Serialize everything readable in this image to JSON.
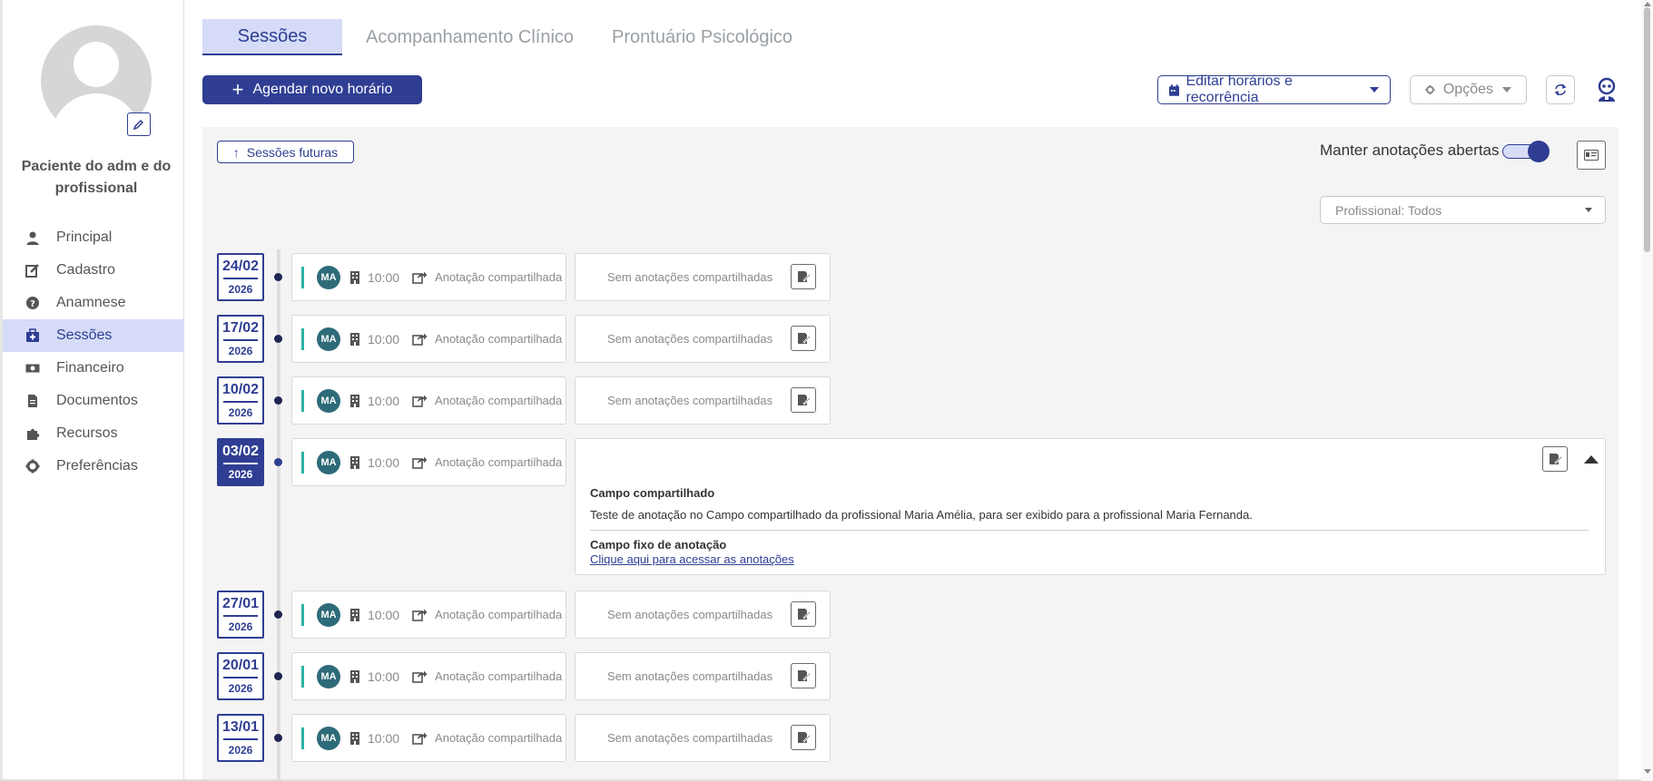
{
  "sidebar": {
    "patient_name": "Paciente do adm e do profissional",
    "items": [
      {
        "label": "Principal",
        "icon": "user-icon"
      },
      {
        "label": "Cadastro",
        "icon": "edit-icon"
      },
      {
        "label": "Anamnese",
        "icon": "question-icon"
      },
      {
        "label": "Sessões",
        "icon": "medical-kit-icon",
        "active": true
      },
      {
        "label": "Financeiro",
        "icon": "money-icon"
      },
      {
        "label": "Documentos",
        "icon": "document-icon"
      },
      {
        "label": "Recursos",
        "icon": "puzzle-icon"
      },
      {
        "label": "Preferências",
        "icon": "gear-icon"
      }
    ]
  },
  "tabs": [
    "Sessões",
    "Acompanhamento Clínico",
    "Prontuário Psicológico"
  ],
  "toolbar": {
    "schedule_label": "Agendar novo horário",
    "edit_schedule_label": "Editar horários e recorrência",
    "options_label": "Opções"
  },
  "panel": {
    "future_sessions_label": "Sessões futuras",
    "keep_notes_label": "Manter anotações abertas",
    "keep_notes_on": true,
    "professional_filter": "Profissional: Todos"
  },
  "sessions": [
    {
      "date": "24/02",
      "year": "2026",
      "initials": "MA",
      "time": "10:00",
      "share_label": "Anotação compartilhada",
      "notes": "Sem anotações compartilhadas"
    },
    {
      "date": "17/02",
      "year": "2026",
      "initials": "MA",
      "time": "10:00",
      "share_label": "Anotação compartilhada",
      "notes": "Sem anotações compartilhadas"
    },
    {
      "date": "10/02",
      "year": "2026",
      "initials": "MA",
      "time": "10:00",
      "share_label": "Anotação compartilhada",
      "notes": "Sem anotações compartilhadas"
    },
    {
      "date": "03/02",
      "year": "2026",
      "initials": "MA",
      "time": "10:00",
      "share_label": "Anotação compartilhada",
      "expanded": true,
      "shared_field_title": "Campo compartilhado",
      "shared_field_text": "Teste de anotação no Campo compartilhado da profissional Maria Amélia, para ser exibido para a profissional Maria Fernanda.",
      "fixed_field_title": "Campo fixo de anotação",
      "fixed_field_link": "Clique aqui para acessar as anotações"
    },
    {
      "date": "27/01",
      "year": "2026",
      "initials": "MA",
      "time": "10:00",
      "share_label": "Anotação compartilhada",
      "notes": "Sem anotações compartilhadas"
    },
    {
      "date": "20/01",
      "year": "2026",
      "initials": "MA",
      "time": "10:00",
      "share_label": "Anotação compartilhada",
      "notes": "Sem anotações compartilhadas"
    },
    {
      "date": "13/01",
      "year": "2026",
      "initials": "MA",
      "time": "10:00",
      "share_label": "Anotação compartilhada",
      "notes": "Sem anotações compartilhadas"
    }
  ],
  "colors": {
    "primary": "#2f3e93",
    "active_bg": "#d6dcf8",
    "session_bar": "#2ab3a3",
    "avatar_bg": "#2e6b78"
  }
}
